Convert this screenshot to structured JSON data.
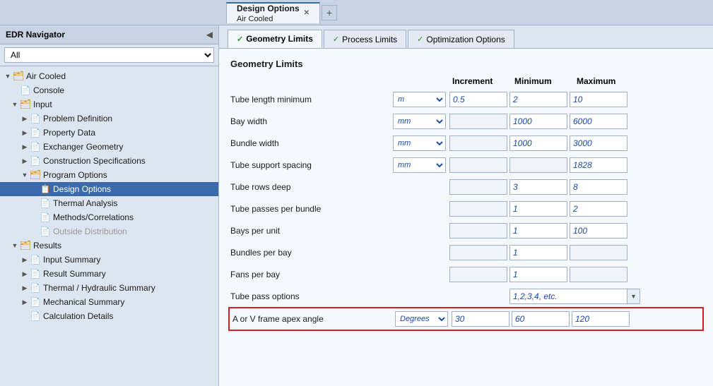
{
  "app": {
    "title": "EDR Navigator",
    "collapse_btn": "◀",
    "filter_option": "All"
  },
  "top_tabs": [
    {
      "label": "Design Options",
      "subtitle": "Air Cooled",
      "active": true,
      "closable": true
    },
    {
      "label": "+",
      "add": true
    }
  ],
  "sidebar": {
    "header": "EDR Navigator",
    "filter": "All",
    "tree": [
      {
        "level": 0,
        "type": "folder",
        "toggle": "▼",
        "label": "Air Cooled",
        "expanded": true
      },
      {
        "level": 1,
        "type": "page",
        "toggle": "",
        "label": "Console"
      },
      {
        "level": 1,
        "type": "folder",
        "toggle": "▼",
        "label": "Input",
        "expanded": true
      },
      {
        "level": 2,
        "type": "page",
        "toggle": "▶",
        "label": "Problem Definition"
      },
      {
        "level": 2,
        "type": "page",
        "toggle": "▶",
        "label": "Property Data"
      },
      {
        "level": 2,
        "type": "page",
        "toggle": "▶",
        "label": "Exchanger Geometry"
      },
      {
        "level": 2,
        "type": "page",
        "toggle": "▶",
        "label": "Construction Specifications"
      },
      {
        "level": 2,
        "type": "folder",
        "toggle": "▼",
        "label": "Program Options",
        "expanded": true
      },
      {
        "level": 3,
        "type": "page",
        "toggle": "",
        "label": "Design Options",
        "selected": true
      },
      {
        "level": 3,
        "type": "page",
        "toggle": "",
        "label": "Thermal Analysis"
      },
      {
        "level": 3,
        "type": "page",
        "toggle": "",
        "label": "Methods/Correlations"
      },
      {
        "level": 3,
        "type": "page-gray",
        "toggle": "",
        "label": "Outside Distribution"
      },
      {
        "level": 1,
        "type": "folder",
        "toggle": "▼",
        "label": "Results",
        "expanded": true
      },
      {
        "level": 2,
        "type": "page",
        "toggle": "▶",
        "label": "Input Summary"
      },
      {
        "level": 2,
        "type": "page",
        "toggle": "▶",
        "label": "Result Summary"
      },
      {
        "level": 2,
        "type": "page",
        "toggle": "▶",
        "label": "Thermal / Hydraulic Summary"
      },
      {
        "level": 2,
        "type": "page",
        "toggle": "▶",
        "label": "Mechanical Summary"
      },
      {
        "level": 2,
        "type": "page",
        "toggle": "",
        "label": "Calculation Details"
      }
    ]
  },
  "inner_tabs": [
    {
      "label": "Geometry Limits",
      "active": true,
      "checked": true
    },
    {
      "label": "Process Limits",
      "active": false,
      "checked": true
    },
    {
      "label": "Optimization Options",
      "active": false,
      "checked": true
    }
  ],
  "form": {
    "title": "Geometry Limits",
    "headers": {
      "increment": "Increment",
      "minimum": "Minimum",
      "maximum": "Maximum"
    },
    "rows": [
      {
        "label": "Tube length minimum",
        "unit": "m",
        "has_unit": true,
        "increment": "0.5",
        "minimum": "2",
        "maximum": "10",
        "highlighted": false
      },
      {
        "label": "Bay width",
        "unit": "mm",
        "has_unit": true,
        "increment": "",
        "minimum": "1000",
        "maximum": "6000",
        "highlighted": false
      },
      {
        "label": "Bundle width",
        "unit": "mm",
        "has_unit": true,
        "increment": "",
        "minimum": "1000",
        "maximum": "3000",
        "highlighted": false
      },
      {
        "label": "Tube support spacing",
        "unit": "mm",
        "has_unit": true,
        "increment": "",
        "minimum": "",
        "maximum": "1828",
        "highlighted": false
      },
      {
        "label": "Tube rows deep",
        "unit": "",
        "has_unit": false,
        "increment": "",
        "minimum": "3",
        "maximum": "8",
        "highlighted": false
      },
      {
        "label": "Tube passes per bundle",
        "unit": "",
        "has_unit": false,
        "increment": "",
        "minimum": "1",
        "maximum": "2",
        "highlighted": false
      },
      {
        "label": "Bays per unit",
        "unit": "",
        "has_unit": false,
        "increment": "",
        "minimum": "1",
        "maximum": "100",
        "highlighted": false
      },
      {
        "label": "Bundles per bay",
        "unit": "",
        "has_unit": false,
        "increment": "",
        "minimum": "1",
        "maximum": "",
        "highlighted": false
      },
      {
        "label": "Fans per bay",
        "unit": "",
        "has_unit": false,
        "increment": "",
        "minimum": "1",
        "maximum": "",
        "highlighted": false
      },
      {
        "label": "Tube pass options",
        "unit": "",
        "has_unit": false,
        "is_dropdown": true,
        "dropdown_value": "1,2,3,4, etc.",
        "increment": "",
        "minimum": "",
        "maximum": "",
        "highlighted": false
      },
      {
        "label": "A or V frame apex angle",
        "unit": "Degrees",
        "has_unit": true,
        "increment": "30",
        "minimum": "60",
        "maximum": "120",
        "highlighted": true
      }
    ]
  }
}
